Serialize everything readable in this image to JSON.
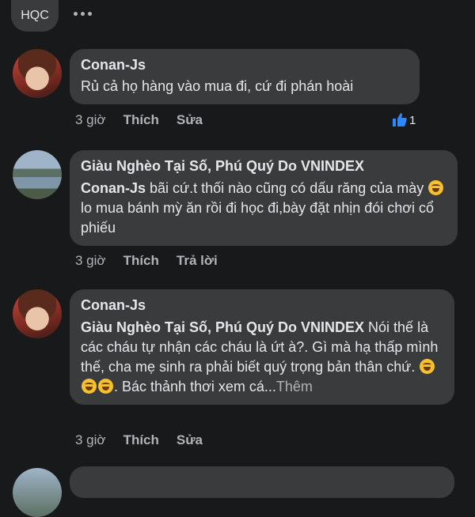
{
  "header": {
    "chip_label": "HQC",
    "more_icon": "more-horizontal-icon"
  },
  "comments": [
    {
      "author": "Conan-Js",
      "text": "Rủ cả họ hàng vào mua đi, cứ đi phán hoài",
      "time": "3 giờ",
      "action1": "Thích",
      "action2": "Sửa",
      "like_count": "1"
    },
    {
      "author": "Giàu Nghèo Tại Số, Phú Quý Do VNINDEX",
      "mention": "Conan-Js",
      "text_a": "  bãi cứ.t thối nào cũng có dấu răng của mày ",
      "text_b": "lo mua bánh mỳ ăn rồi đi học đi,bày đặt nhịn đói chơi cổ phiếu",
      "time": "3 giờ",
      "action1": "Thích",
      "action2": "Trả lời"
    },
    {
      "author": "Conan-Js",
      "mention": "Giàu Nghèo Tại Số, Phú Quý Do VNINDEX",
      "text_a": "  Nói thế là các cháu tự nhận các cháu là ứt à?. Gì mà hạ thấp mình thế, cha mẹ sinh ra phải biết quý trọng bản thân chứ. ",
      "text_b": ". Bác thảnh thơi xem cá...",
      "see_more": "Thêm",
      "time": "3 giờ",
      "action1": "Thích",
      "action2": "Sửa"
    }
  ],
  "colors": {
    "background": "#18191a",
    "bubble": "#3a3b3c",
    "like_blue": "#2d88ff"
  }
}
